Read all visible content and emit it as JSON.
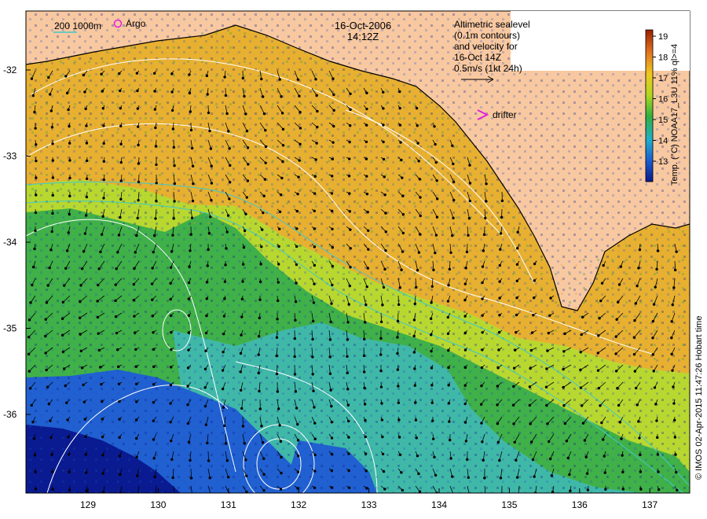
{
  "header": {
    "date": "16-Oct-2006",
    "time": "14:12Z"
  },
  "legend_left": {
    "isobath_label": "200  1000m",
    "argo_label": "Argo"
  },
  "info_box": {
    "line1": "Altimetric sealevel",
    "line2": "(0.1m contours)",
    "line3": "and velocity for",
    "line4": "16-Oct 14Z",
    "line5": "0.5m/s (1kt 24h)"
  },
  "drifter": {
    "label": "drifter"
  },
  "colorbar": {
    "title": "Temp. (°C) NOAA17_L3U 11% ql>=4",
    "ticks": [
      "13",
      "14",
      "15",
      "16",
      "17",
      "18",
      "19"
    ],
    "colors": [
      "#0a1a8c",
      "#1a5fd0",
      "#20b0c8",
      "#30b040",
      "#b0d820",
      "#f0c820",
      "#e07020",
      "#9a2000"
    ]
  },
  "credit": "© IMOS 02-Apr-2015 11:47:26 Hobart time",
  "axes": {
    "x_ticks": [
      "129",
      "130",
      "131",
      "132",
      "133",
      "134",
      "135",
      "136",
      "137"
    ],
    "y_ticks": [
      "-32",
      "-33",
      "-34",
      "-35",
      "-36"
    ]
  },
  "colors": {
    "land": "#f8c8a0",
    "warm": "#e8b030",
    "mid": "#b8d830",
    "green": "#40b048",
    "cyan": "#40b8a8",
    "blue": "#2060d0",
    "deep": "#0a1a90",
    "argo": "#e020e0",
    "isobath_200": "#40c8c8",
    "contours": "#ffffff"
  }
}
